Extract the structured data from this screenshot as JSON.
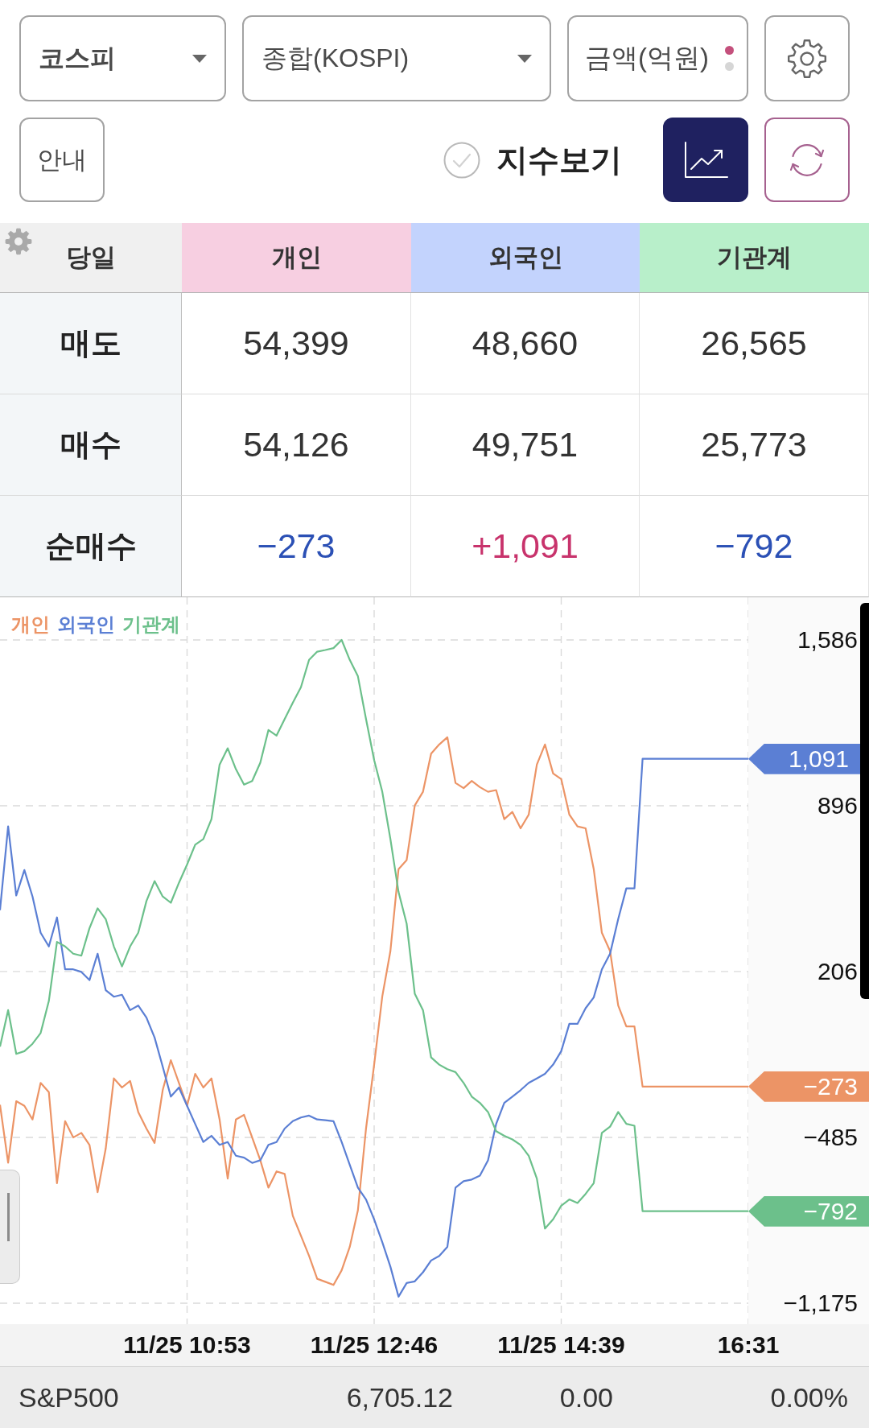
{
  "controls": {
    "market_select": {
      "value": "코스피"
    },
    "index_select": {
      "value": "종합(KOSPI)"
    },
    "unit_toggle": {
      "label": "금액(억원)",
      "dots": [
        {
          "selected": true
        },
        {
          "selected": false
        }
      ]
    },
    "guide_button": {
      "label": "안내"
    },
    "index_view": {
      "label": "지수보기",
      "checked": false
    },
    "chart_view": {
      "on": true
    }
  },
  "table": {
    "columns": [
      {
        "label": "당일"
      },
      {
        "label": "개인",
        "color": "#f7cfe1"
      },
      {
        "label": "외국인",
        "color": "#c3d3fd"
      },
      {
        "label": "기관계",
        "color": "#b8efca"
      }
    ],
    "rows": [
      {
        "cells": [
          {
            "value": "매도"
          },
          {
            "value": "54,399"
          },
          {
            "value": "48,660"
          },
          {
            "value": "26,565"
          }
        ]
      },
      {
        "cells": [
          {
            "value": "매수"
          },
          {
            "value": "54,126"
          },
          {
            "value": "49,751"
          },
          {
            "value": "25,773"
          }
        ]
      },
      {
        "cells": [
          {
            "value": "순매수"
          },
          {
            "value": "−273",
            "color": "#2b50b5"
          },
          {
            "value": "+1,091",
            "color": "#c8336c"
          },
          {
            "value": "−792",
            "color": "#2b50b5"
          }
        ]
      }
    ]
  },
  "chart": {
    "chart_data": {
      "type": "line",
      "grid": true,
      "categories": [
        null,
        null,
        null,
        null,
        null,
        null,
        null,
        null,
        null,
        null,
        null,
        null,
        null,
        null,
        null,
        null,
        null,
        null,
        null,
        null,
        null,
        null,
        null,
        "11/25 10:53",
        null,
        null,
        null,
        null,
        null,
        null,
        null,
        null,
        null,
        null,
        null,
        null,
        null,
        null,
        null,
        null,
        null,
        null,
        null,
        null,
        null,
        null,
        "11/25 12:46",
        null,
        null,
        null,
        null,
        null,
        null,
        null,
        null,
        null,
        null,
        null,
        null,
        null,
        null,
        null,
        null,
        null,
        null,
        null,
        null,
        null,
        null,
        "11/25 14:39",
        null,
        null,
        null,
        null,
        null,
        null,
        null,
        null,
        null,
        null,
        null,
        null,
        null,
        null,
        null,
        null,
        null,
        null,
        null,
        null,
        null,
        null,
        "16:31"
      ],
      "series": [
        {
          "name": "개인",
          "color": "#ec9466",
          "values": [
            -349,
            -590,
            -334,
            -353,
            -410,
            -258,
            -296,
            -675,
            -417,
            -485,
            -466,
            -516,
            -713,
            -531,
            -239,
            -277,
            -250,
            -379,
            -448,
            -508,
            -288,
            -163,
            -258,
            -353,
            -220,
            -277,
            -239,
            -410,
            -656,
            -410,
            -391,
            -485,
            -580,
            -694,
            -626,
            -637,
            -811,
            -894,
            -978,
            -1073,
            -1086,
            -1099,
            -1038,
            -940,
            -788,
            -448,
            -182,
            102,
            291,
            632,
            670,
            897,
            954,
            1113,
            1151,
            1181,
            991,
            969,
            999,
            973,
            954,
            961,
            840,
            870,
            802,
            859,
            1067,
            1151,
            1030,
            1007,
            859,
            810,
            802,
            632,
            367,
            291,
            64,
            -23,
            -23,
            -273,
            -273,
            -273,
            -273,
            -273,
            -273,
            -273,
            -273,
            -273,
            -273,
            -273,
            -273,
            -273,
            -273
          ]
        },
        {
          "name": "외국인",
          "color": "#5b7fd4",
          "values": [
            461,
            810,
            522,
            628,
            518,
            367,
            310,
            431,
            215,
            215,
            204,
            170,
            280,
            128,
            101,
            109,
            45,
            64,
            14,
            -69,
            -190,
            -315,
            -277,
            -353,
            -429,
            -504,
            -478,
            -516,
            -504,
            -561,
            -569,
            -591,
            -580,
            -516,
            -504,
            -448,
            -417,
            -402,
            -394,
            -410,
            -413,
            -417,
            -504,
            -599,
            -694,
            -743,
            -826,
            -921,
            -1023,
            -1148,
            -1091,
            -1084,
            -1046,
            -997,
            -978,
            -940,
            -694,
            -667,
            -660,
            -644,
            -580,
            -429,
            -341,
            -315,
            -288,
            -258,
            -239,
            -220,
            -182,
            -126,
            -12,
            -12,
            53,
            98,
            215,
            280,
            424,
            552,
            552,
            1091,
            1091,
            1091,
            1091,
            1091,
            1091,
            1091,
            1091,
            1091,
            1091,
            1091,
            1091,
            1091,
            1091
          ]
        },
        {
          "name": "기관계",
          "color": "#6cc08b",
          "values": [
            -107,
            45,
            -137,
            -126,
            -95,
            -50,
            83,
            329,
            310,
            280,
            272,
            386,
            469,
            424,
            310,
            227,
            310,
            367,
            499,
            582,
            518,
            492,
            575,
            651,
            734,
            757,
            840,
            1067,
            1135,
            1048,
            984,
            999,
            1075,
            1211,
            1188,
            1257,
            1325,
            1389,
            1503,
            1537,
            1544,
            1552,
            1586,
            1503,
            1435,
            1257,
            1086,
            954,
            757,
            537,
            405,
            113,
            45,
            -152,
            -182,
            -201,
            -213,
            -258,
            -315,
            -341,
            -379,
            -459,
            -478,
            -493,
            -516,
            -561,
            -656,
            -864,
            -826,
            -769,
            -743,
            -758,
            -720,
            -675,
            -466,
            -440,
            -379,
            -428,
            -436,
            -792,
            -792,
            -792,
            -792,
            -792,
            -792,
            -792,
            -792,
            -792,
            -792,
            -792,
            -792,
            -792,
            -792
          ]
        }
      ],
      "ylim": [
        -1175,
        1586
      ],
      "yticks": [
        {
          "value": 1586,
          "label": "1,586"
        },
        {
          "value": 896,
          "label": "896"
        },
        {
          "value": 206,
          "label": "206"
        },
        {
          "value": -485,
          "label": "−485"
        },
        {
          "value": -1175,
          "label": "−1,175"
        }
      ]
    },
    "value_tags": [
      {
        "label": "1,091"
      },
      {
        "label": "−273"
      },
      {
        "label": "−792"
      }
    ]
  },
  "index_bar": {
    "name": "S&P500",
    "price": "6,705.12",
    "change": "0.00",
    "change_rate": "0.00%"
  }
}
